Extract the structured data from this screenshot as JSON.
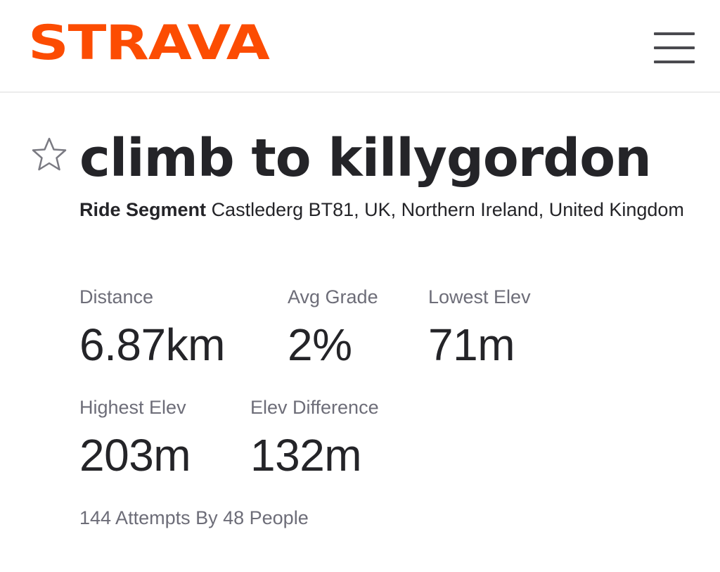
{
  "header": {
    "logo": "STRAVA",
    "menu_icon": "hamburger-menu-icon"
  },
  "segment": {
    "favorite_icon": "star-outline-icon",
    "title": "climb to killygordon",
    "type": "Ride Segment",
    "location": "Castlederg BT81, UK, Northern Ireland, United Kingdom"
  },
  "stats": {
    "distance": {
      "label": "Distance",
      "value": "6.87km"
    },
    "avg_grade": {
      "label": "Avg Grade",
      "value": "2%"
    },
    "lowest_elev": {
      "label": "Lowest Elev",
      "value": "71m"
    },
    "highest_elev": {
      "label": "Highest Elev",
      "value": "203m"
    },
    "elev_difference": {
      "label": "Elev Difference",
      "value": "132m"
    }
  },
  "attempts": "144 Attempts By 48 People",
  "colors": {
    "brand": "#fc4c02",
    "text": "#242428",
    "muted": "#6d6d78"
  }
}
